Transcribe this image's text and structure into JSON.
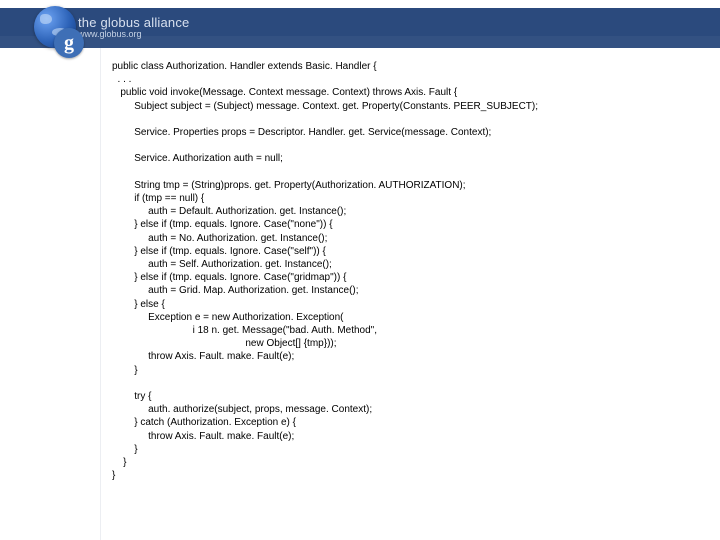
{
  "banner": {
    "title": "the globus alliance",
    "url": "www.globus.org",
    "g": "g"
  },
  "code": {
    "text": "public class Authorization. Handler extends Basic. Handler {\n  . . .\n   public void invoke(Message. Context message. Context) throws Axis. Fault {\n        Subject subject = (Subject) message. Context. get. Property(Constants. PEER_SUBJECT);\n\n        Service. Properties props = Descriptor. Handler. get. Service(message. Context);\n\n        Service. Authorization auth = null;\n\n        String tmp = (String)props. get. Property(Authorization. AUTHORIZATION);\n        if (tmp == null) {\n             auth = Default. Authorization. get. Instance();\n        } else if (tmp. equals. Ignore. Case(\"none\")) {\n             auth = No. Authorization. get. Instance();\n        } else if (tmp. equals. Ignore. Case(\"self\")) {\n             auth = Self. Authorization. get. Instance();\n        } else if (tmp. equals. Ignore. Case(\"gridmap\")) {\n             auth = Grid. Map. Authorization. get. Instance();\n        } else {\n             Exception e = new Authorization. Exception(\n                             i 18 n. get. Message(\"bad. Auth. Method\",\n                                                new Object[] {tmp}));\n             throw Axis. Fault. make. Fault(e);\n        }\n\n        try {\n             auth. authorize(subject, props, message. Context);\n        } catch (Authorization. Exception e) {\n             throw Axis. Fault. make. Fault(e);\n        }\n    }\n}"
  }
}
